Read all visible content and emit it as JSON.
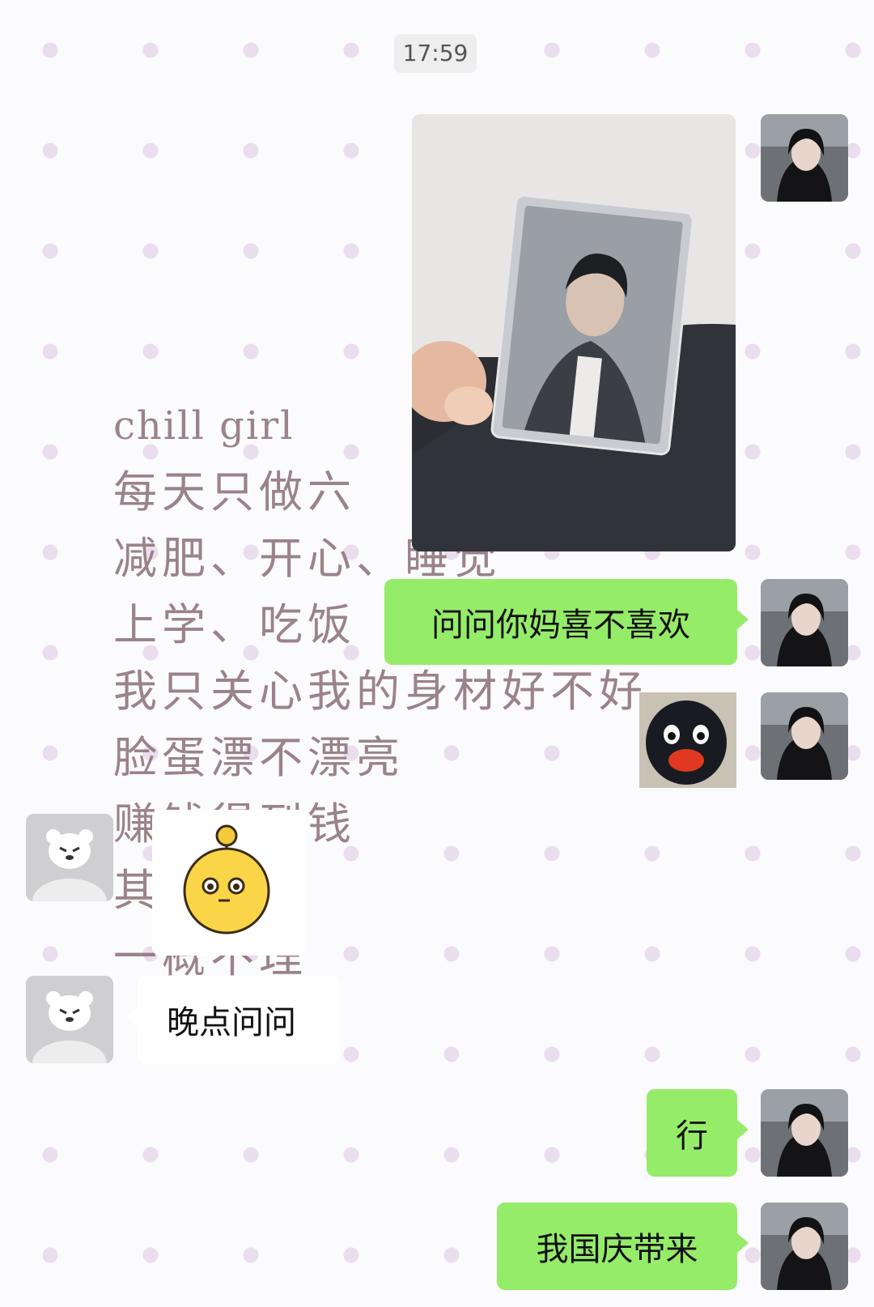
{
  "chat": {
    "timestamp": "17:59",
    "wallpaper_lines": [
      "chill girl",
      "每天只做六",
      "减肥、开心、睡觉",
      "上学、吃饭",
      "我只关心我的身材好不好",
      "脸蛋漂不漂亮",
      "赚钱得到钱",
      "其人烂事",
      "一概不理"
    ],
    "messages": [
      {
        "side": "right",
        "kind": "image",
        "description_icon": "photo-card-image"
      },
      {
        "side": "right",
        "kind": "text",
        "text": "问问你妈喜不喜欢"
      },
      {
        "side": "right",
        "kind": "sticker",
        "icon": "penguin-sticker"
      },
      {
        "side": "left",
        "kind": "sticker",
        "icon": "yellow-blob-sticker"
      },
      {
        "side": "left",
        "kind": "text",
        "text": "晚点问问"
      },
      {
        "side": "right",
        "kind": "text",
        "text": "行"
      },
      {
        "side": "right",
        "kind": "text",
        "text": "我国庆带来"
      }
    ]
  },
  "colors": {
    "bubble_me": "#95ec69",
    "bubble_other": "#ffffff",
    "wallpaper_dot": "#e9ddee",
    "wallpaper_text": "#8a6f75"
  }
}
